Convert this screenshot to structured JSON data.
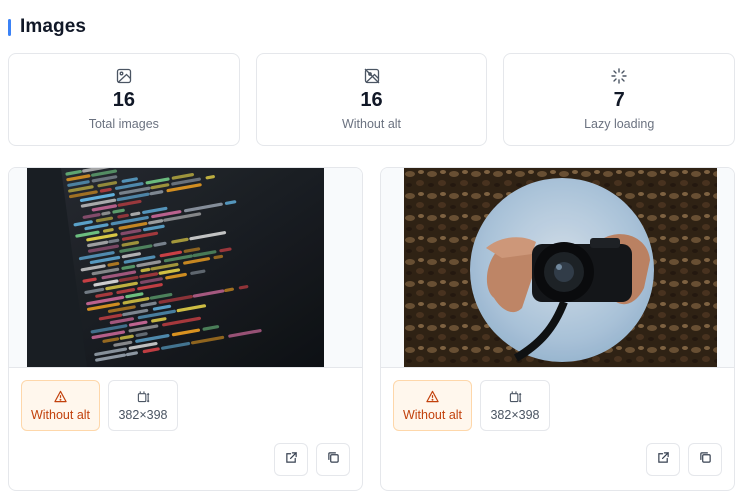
{
  "section": {
    "title": "Images",
    "accent_color": "#3b82f6"
  },
  "stats": [
    {
      "icon": "image-icon",
      "value": "16",
      "label": "Total images"
    },
    {
      "icon": "image-off-icon",
      "value": "16",
      "label": "Without alt"
    },
    {
      "icon": "loader-icon",
      "value": "7",
      "label": "Lazy loading"
    }
  ],
  "images": [
    {
      "subject": "code-screenshot",
      "alt_badge": {
        "icon": "warning-icon",
        "label": "Without alt",
        "color": "#c2410c"
      },
      "size_badge": {
        "icon": "dimensions-icon",
        "label": "382×398"
      },
      "actions": [
        {
          "icon": "external-link-icon"
        },
        {
          "icon": "copy-icon"
        }
      ]
    },
    {
      "subject": "camera-lens-photo",
      "alt_badge": {
        "icon": "warning-icon",
        "label": "Without alt",
        "color": "#c2410c"
      },
      "size_badge": {
        "icon": "dimensions-icon",
        "label": "382×398"
      },
      "actions": [
        {
          "icon": "external-link-icon"
        },
        {
          "icon": "copy-icon"
        }
      ]
    }
  ]
}
